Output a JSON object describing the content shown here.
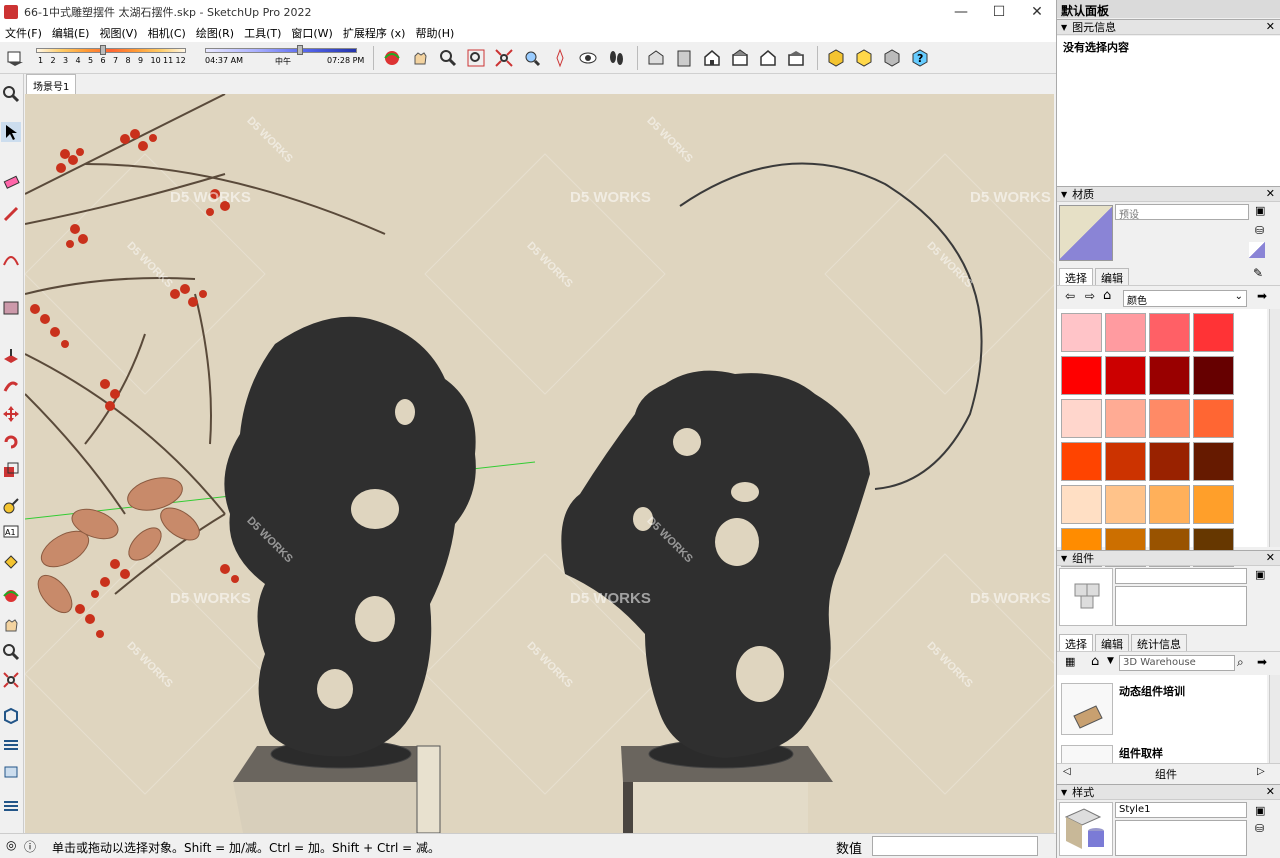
{
  "window": {
    "title": "66-1中式雕塑摆件 太湖石摆件.skp - SketchUp Pro 2022",
    "minimize": "—",
    "maximize": "☐",
    "close": "✕"
  },
  "menu": [
    "文件(F)",
    "编辑(E)",
    "视图(V)",
    "相机(C)",
    "绘图(R)",
    "工具(T)",
    "窗口(W)",
    "扩展程序 (x)",
    "帮助(H)"
  ],
  "toolbar": {
    "month_ticks": [
      "1",
      "2",
      "3",
      "4",
      "5",
      "6",
      "7",
      "8",
      "9",
      "10",
      "11",
      "12"
    ],
    "time_start": "04:37 AM",
    "time_mid": "中午",
    "time_end": "07:28 PM"
  },
  "scene": {
    "tab_label": "场景号1"
  },
  "viewport": {
    "watermark_big": "D5 WORKS",
    "watermark_small": "D5 WORKS"
  },
  "status": {
    "hint": "单击或拖动以选择对象。Shift = 加/减。Ctrl = 加。Shift + Ctrl = 减。",
    "value_label": "数值",
    "value": ""
  },
  "right_panel": {
    "title": "默认面板",
    "entity_info": {
      "header": "图元信息",
      "content": "没有选择内容"
    },
    "materials": {
      "header": "材质",
      "name_placeholder": "预设",
      "tab_select": "选择",
      "tab_edit": "编辑",
      "library": "颜色",
      "swatches": [
        "#ffc4c8",
        "#ff9ba0",
        "#ff6066",
        "#ff3336",
        "#ff0000",
        "#cc0000",
        "#990000",
        "#660000",
        "#ffd6cc",
        "#ffab94",
        "#ff8a66",
        "#ff6633",
        "#ff4400",
        "#cc3300",
        "#992200",
        "#661a00",
        "#ffdfc4",
        "#ffc38a",
        "#ffb05a",
        "#ff9f2a",
        "#ff8c00",
        "#cc6f00",
        "#995300",
        "#663700"
      ]
    },
    "components": {
      "header": "组件",
      "tab_select": "选择",
      "tab_edit": "编辑",
      "tab_stats": "统计信息",
      "search_placeholder": "3D Warehouse",
      "items": [
        "动态组件培训",
        "组件取样"
      ],
      "footer": "组件"
    },
    "styles": {
      "header": "样式",
      "style_name": "Style1"
    }
  }
}
